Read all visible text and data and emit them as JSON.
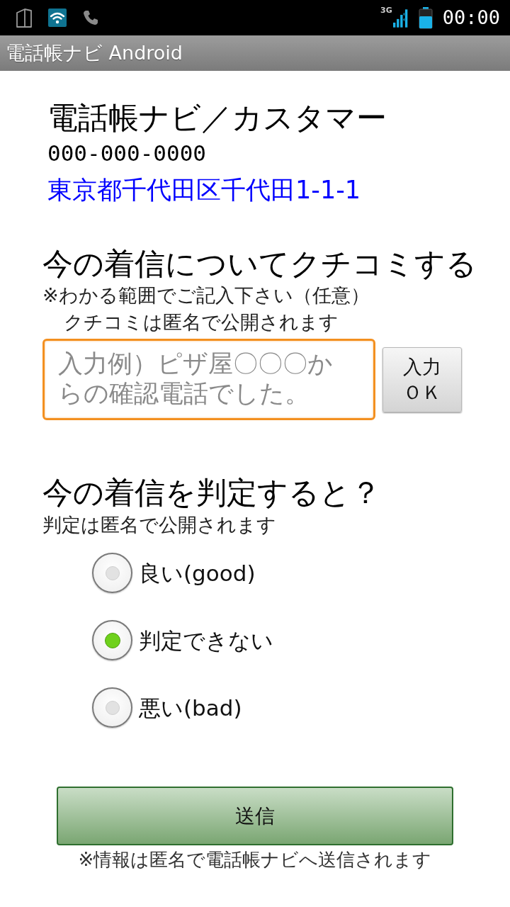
{
  "status_bar": {
    "network": "3G",
    "time": "00:00"
  },
  "app_bar": {
    "title": "電話帳ナビ Android"
  },
  "contact": {
    "name": "電話帳ナビ／カスタマー",
    "phone": "000-000-0000",
    "address": "東京都千代田区千代田1-1-1"
  },
  "review": {
    "heading": "今の着信についてクチコミする",
    "hint": "※わかる範囲でご記入下さい（任意）",
    "notice": "クチコミは匿名で公開されます",
    "input": {
      "placeholder": "入力例）ピザ屋〇〇〇からの確認電話でした。"
    },
    "button": "入力ＯＫ"
  },
  "rating": {
    "heading": "今の着信を判定すると？",
    "note": "判定は匿名で公開されます",
    "options": [
      {
        "label": "良い(good)",
        "selected": false
      },
      {
        "label": "判定できない",
        "selected": true
      },
      {
        "label": "悪い(bad)",
        "selected": false
      }
    ]
  },
  "submit": {
    "label": "送信",
    "note": "※情報は匿名で電話帳ナビへ送信されます"
  }
}
